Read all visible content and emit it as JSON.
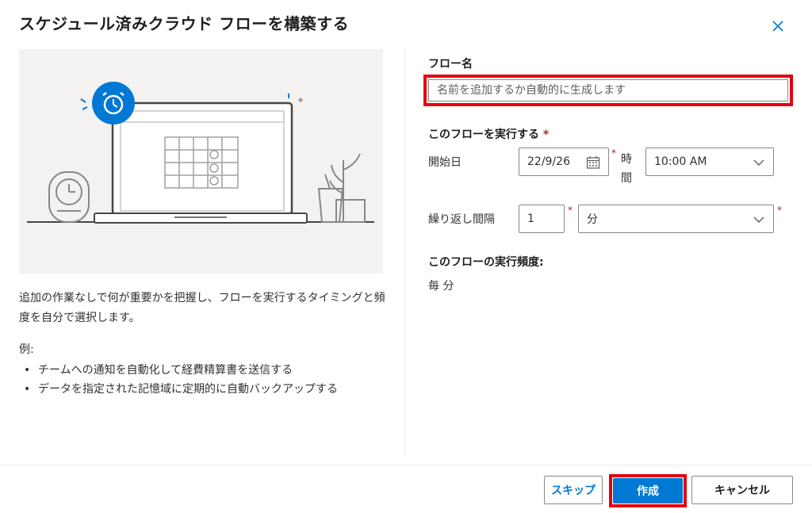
{
  "dialog": {
    "title": "スケジュール済みクラウド フローを構築する",
    "close_icon": "close-icon"
  },
  "left": {
    "description": "追加の作業なしで何が重要かを把握し、フローを実行するタイミングと頻度を自分で選択します。",
    "examples_label": "例:",
    "examples": [
      "チームへの通知を自動化して経費精算書を送信する",
      "データを指定された記憶域に定期的に自動バックアップする"
    ]
  },
  "form": {
    "flow_name_label": "フロー名",
    "flow_name_placeholder": "名前を追加するか自動的に生成します",
    "run_label": "このフローを実行する",
    "required_mark": "*",
    "start_date_label": "開始日",
    "start_date_value": "22/9/26",
    "time_label_1": "時",
    "time_label_2": "間",
    "time_value": "10:00 AM",
    "repeat_label": "繰り返し間隔",
    "repeat_count": "1",
    "repeat_unit": "分",
    "frequency_label": "このフローの実行頻度:",
    "frequency_value": "毎 分"
  },
  "footer": {
    "skip_label": "スキップ",
    "create_label": "作成",
    "cancel_label": "キャンセル"
  },
  "colors": {
    "accent": "#0078d4",
    "highlight": "#e3000f",
    "required": "#a4262c"
  }
}
